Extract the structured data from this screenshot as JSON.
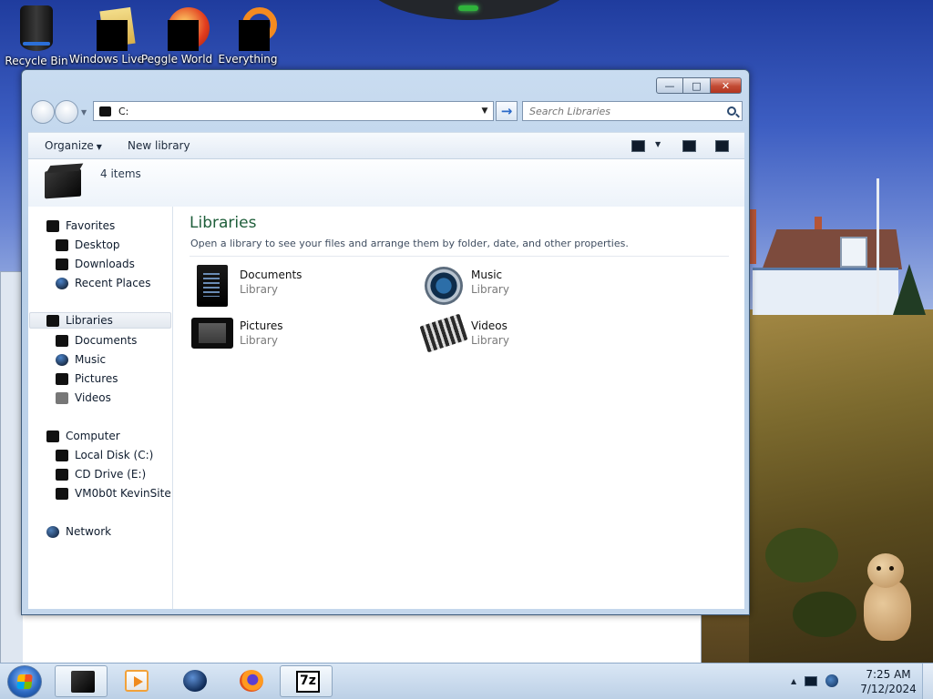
{
  "desktop": {
    "icons": [
      {
        "label": "Recycle Bin",
        "icon": "recycle-bin-icon"
      },
      {
        "label": "Windows Live",
        "icon": "windows-live-icon"
      },
      {
        "label": "Peggle World",
        "icon": "peggle-icon"
      },
      {
        "label": "Everything",
        "icon": "everything-icon"
      }
    ]
  },
  "explorer": {
    "address": "C:",
    "search_placeholder": "Search Libraries",
    "toolbar": {
      "organize": "Organize",
      "new_library": "New library"
    },
    "info": {
      "count": "4 items"
    },
    "nav": {
      "favorites": "Favorites",
      "desktop": "Desktop",
      "downloads": "Downloads",
      "recent": "Recent Places",
      "libraries": "Libraries",
      "documents": "Documents",
      "music": "Music",
      "pictures": "Pictures",
      "videos": "Videos",
      "computer": "Computer",
      "local_disk": "Local Disk (C:)",
      "cd_drive": "CD Drive (E:)",
      "vmsite": "VM0b0t KevinSite",
      "network": "Network"
    },
    "content": {
      "title": "Libraries",
      "description": "Open a library to see your files and arrange them by folder, date, and other properties.",
      "items": [
        {
          "name": "Documents",
          "type": "Library",
          "icon": "documents-library-icon"
        },
        {
          "name": "Music",
          "type": "Library",
          "icon": "music-library-icon"
        },
        {
          "name": "Pictures",
          "type": "Library",
          "icon": "pictures-library-icon"
        },
        {
          "name": "Videos",
          "type": "Library",
          "icon": "videos-library-icon"
        }
      ]
    }
  },
  "taskbar": {
    "clock_time": "7:25 AM",
    "clock_date": "7/12/2024",
    "apps": [
      "explorer-icon",
      "media-player-icon",
      "globe-browser-icon",
      "firefox-icon",
      "7zip-icon"
    ],
    "sevenzip_label": "7z"
  }
}
